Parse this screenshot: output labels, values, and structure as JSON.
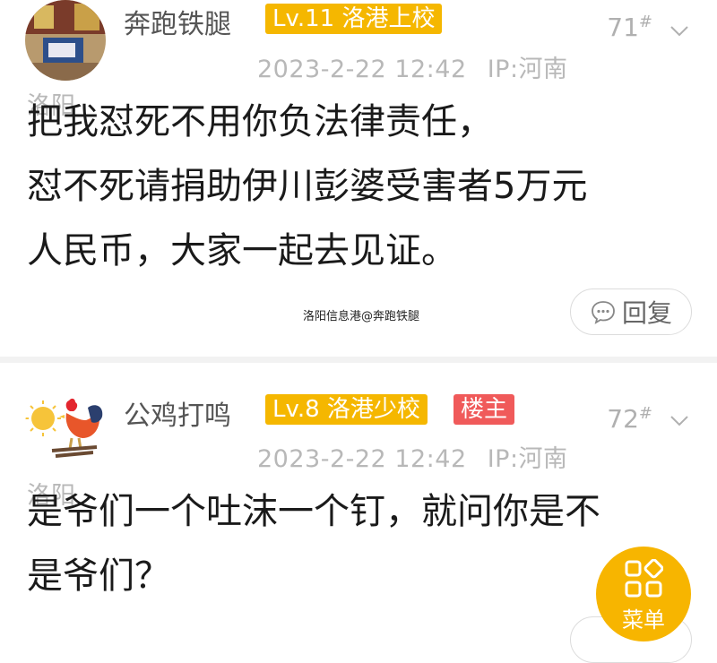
{
  "posts": [
    {
      "username": "奔跑铁腿",
      "level_badge": "Lv.11 洛港上校",
      "floor_num": "71",
      "floor_mark": "#",
      "date": "2023-2-22 12:42",
      "ip": "IP:河南",
      "city": "洛阳",
      "content_lines": [
        "把我怼死不用你负法律责任，",
        "怼不死请捐助伊川彭婆受害者5万元",
        "人民币，大家一起去见证。"
      ],
      "reply_label": "回复"
    },
    {
      "username": "公鸡打鸣",
      "level_badge": "Lv.8 洛港少校",
      "owner_badge": "楼主",
      "floor_num": "72",
      "floor_mark": "#",
      "date": "2023-2-22 12:42",
      "ip": "IP:河南",
      "city": "洛阳",
      "content_lines": [
        "是爷们一个吐沫一个钉，就问你是不",
        "是爷们？"
      ]
    }
  ],
  "watermark": "洛阳信息港@奔跑铁腿",
  "fab_label": "菜单",
  "colors": {
    "level_badge": "#f5b700",
    "owner_badge": "#f05a5a",
    "fab": "#f7b500"
  }
}
